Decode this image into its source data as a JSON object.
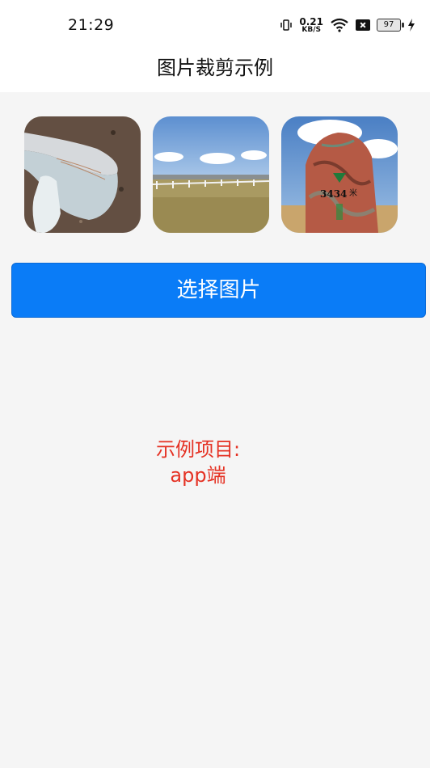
{
  "status_bar": {
    "time": "21:29",
    "net_speed": "0.21",
    "net_unit": "KB/S",
    "battery": "97"
  },
  "nav": {
    "title": "图片裁剪示例"
  },
  "images": [
    {
      "name": "mushroom-photo"
    },
    {
      "name": "grassland-photo"
    },
    {
      "name": "rock-photo",
      "overlay_number": "3434",
      "overlay_unit": "米"
    }
  ],
  "button": {
    "label": "选择图片"
  },
  "note": {
    "line1": "示例项目:",
    "line2": "app端"
  },
  "colors": {
    "accent": "#0a7cf7",
    "note": "#e53224",
    "background": "#f5f5f5"
  }
}
